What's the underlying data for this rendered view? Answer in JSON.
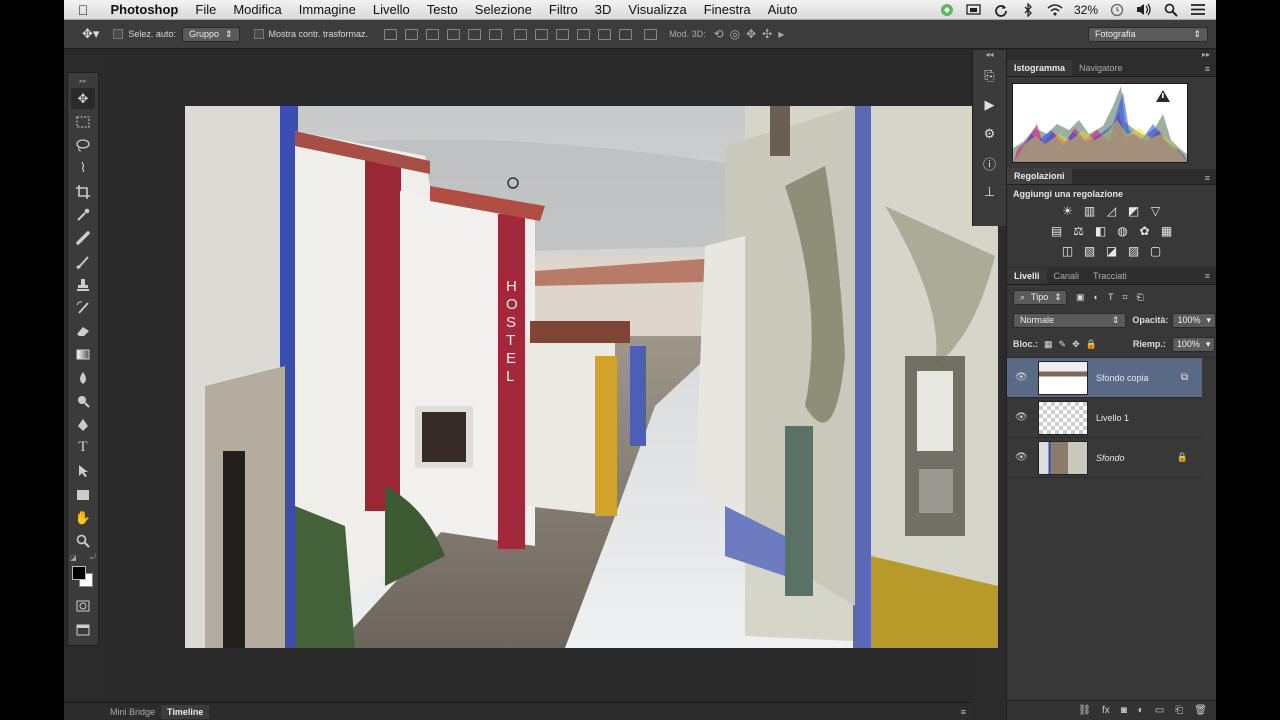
{
  "menubar": {
    "apple": "",
    "items": [
      "Photoshop",
      "File",
      "Modifica",
      "Immagine",
      "Livello",
      "Testo",
      "Selezione",
      "Filtro",
      "3D",
      "Visualizza",
      "Finestra",
      "Aiuto"
    ],
    "battery": "32%"
  },
  "options": {
    "auto_select_label": "Selez. auto:",
    "auto_select_value": "Gruppo",
    "show_transform_label": "Mostra contr. trasformaz.",
    "mode3d_label": "Mod. 3D:",
    "workspace": "Fotografia"
  },
  "panels": {
    "histogram_tab": "Istogramma",
    "navigator_tab": "Navigatore",
    "adjustments_title": "Regolazioni",
    "add_adjustment": "Aggiungi una regolazione",
    "layers_tab": "Livelli",
    "channels_tab": "Canali",
    "paths_tab": "Tracciati",
    "kind_filter": "Tipo",
    "blend_mode": "Normale",
    "opacity_label": "Opacità:",
    "opacity_value": "100%",
    "lock_label": "Bloc.:",
    "fill_label": "Riemp.:",
    "fill_value": "100%",
    "layers": [
      {
        "name": "Sfondo copia",
        "selected": true
      },
      {
        "name": "Livello 1",
        "selected": false
      },
      {
        "name": "Sfondo",
        "selected": false
      }
    ]
  },
  "dock": {
    "mini_bridge": "Mini Bridge",
    "timeline": "Timeline"
  },
  "photo_sign": "HOSTEL"
}
